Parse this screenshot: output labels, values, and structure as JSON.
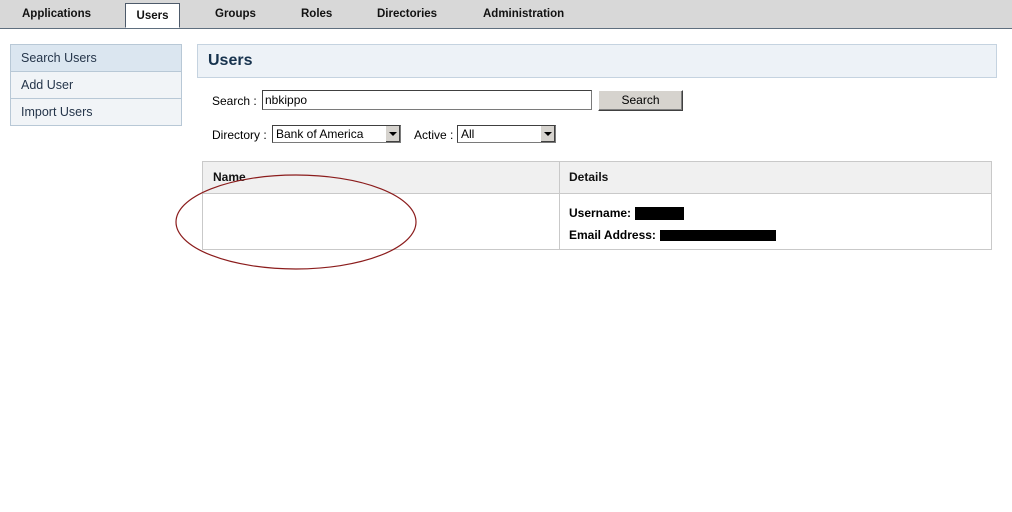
{
  "tabs": [
    {
      "label": "Applications",
      "active": false
    },
    {
      "label": "Users",
      "active": true
    },
    {
      "label": "Groups",
      "active": false
    },
    {
      "label": "Roles",
      "active": false
    },
    {
      "label": "Directories",
      "active": false
    },
    {
      "label": "Administration",
      "active": false
    }
  ],
  "sidebar": {
    "items": [
      {
        "label": "Search Users",
        "active": true
      },
      {
        "label": "Add User",
        "active": false
      },
      {
        "label": "Import Users",
        "active": false
      }
    ]
  },
  "page": {
    "title": "Users"
  },
  "search": {
    "label": "Search :",
    "value": "nbkippo",
    "button_label": "Search"
  },
  "filters": {
    "directory_label": "Directory :",
    "directory_value": "Bank of America",
    "active_label": "Active :",
    "active_value": "All"
  },
  "results": {
    "columns": [
      "Name",
      "Details"
    ],
    "rows": [
      {
        "name": "",
        "username_label": "Username:",
        "email_label": "Email Address:"
      }
    ]
  },
  "colors": {
    "tab_bar": "#d8d8d8",
    "title_text": "#16324d",
    "annotation": "#8b1c1c",
    "redaction": "#000000"
  }
}
